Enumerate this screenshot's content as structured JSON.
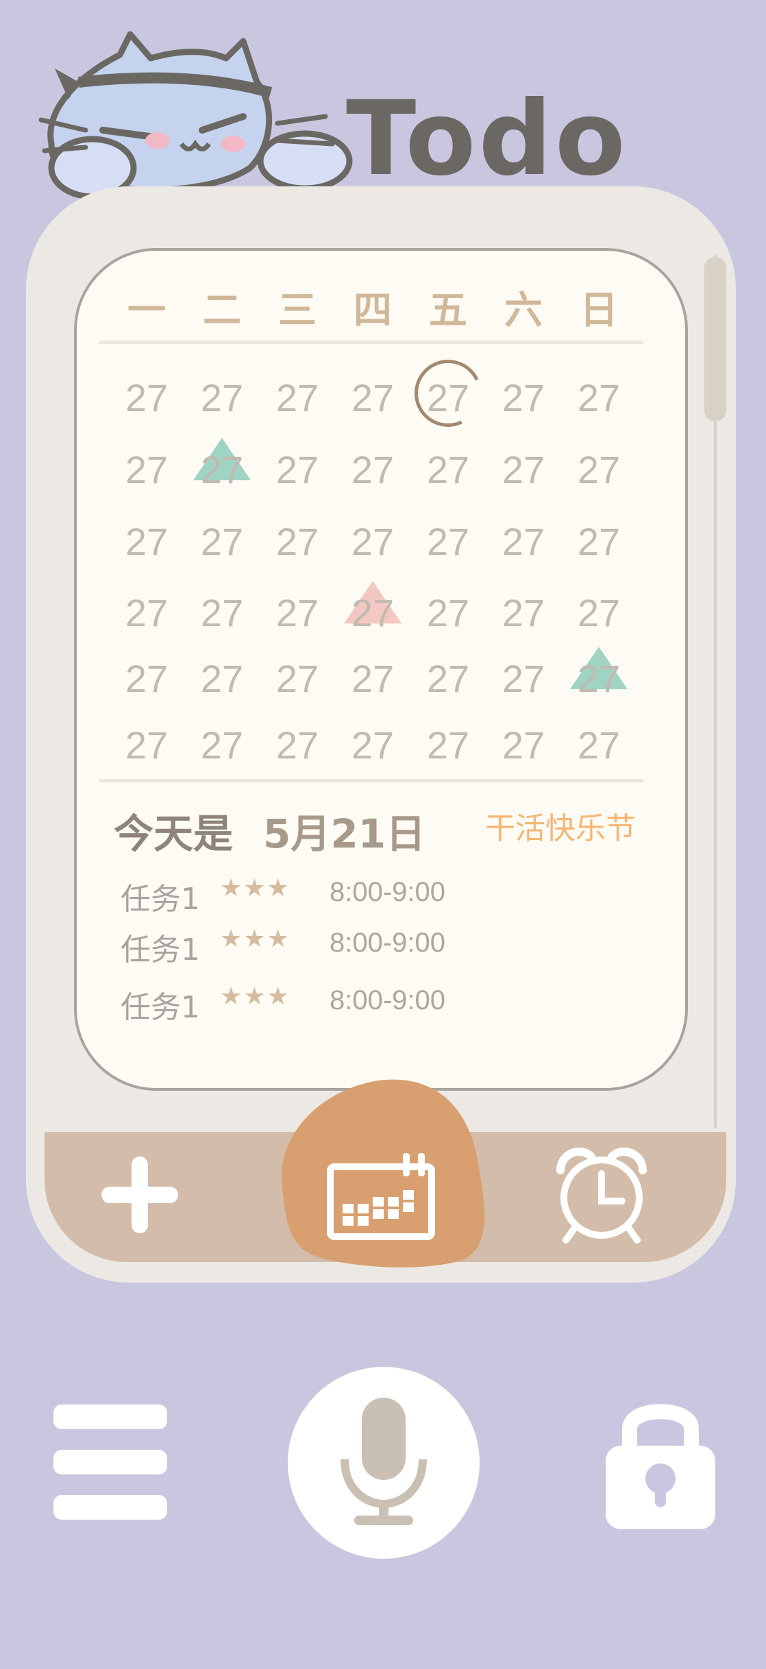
{
  "app": {
    "title": "Todo"
  },
  "calendar": {
    "weekdays": [
      "一",
      "二",
      "三",
      "四",
      "五",
      "六",
      "日"
    ],
    "weeks": [
      [
        "27",
        "27",
        "27",
        "27",
        "27",
        "27",
        "27"
      ],
      [
        "27",
        "27",
        "27",
        "27",
        "27",
        "27",
        "27"
      ],
      [
        "27",
        "27",
        "27",
        "27",
        "27",
        "27",
        "27"
      ],
      [
        "27",
        "27",
        "27",
        "27",
        "27",
        "27",
        "27"
      ],
      [
        "27",
        "27",
        "27",
        "27",
        "27",
        "27",
        "27"
      ],
      [
        "27",
        "27",
        "27",
        "27",
        "27",
        "27",
        "27"
      ]
    ],
    "selected": {
      "week": 0,
      "day": 4
    },
    "markers": [
      {
        "week": 1,
        "day": 1,
        "color": "#9fd3c4"
      },
      {
        "week": 3,
        "day": 3,
        "color": "#f3c7c2"
      },
      {
        "week": 4,
        "day": 6,
        "color": "#9fd3c4"
      }
    ]
  },
  "today": {
    "label": "今天是",
    "date": "5月21日",
    "holiday": "干活快乐节"
  },
  "tasks": [
    {
      "name": "任务1",
      "stars": "★★★",
      "time": "8:00-9:00"
    },
    {
      "name": "任务1",
      "stars": "★★★",
      "time": "8:00-9:00"
    },
    {
      "name": "任务1",
      "stars": "★★★",
      "time": "8:00-9:00"
    }
  ],
  "toolbar": {
    "add_icon": "plus-icon",
    "calendar_icon": "calendar-icon",
    "alarm_icon": "alarm-clock-icon"
  },
  "bottom_nav": {
    "menu_icon": "hamburger-menu-icon",
    "mic_icon": "microphone-icon",
    "lock_icon": "lock-icon"
  },
  "colors": {
    "background": "#c9c7e0",
    "accent": "#d8a070",
    "holiday": "#f6b673",
    "tabbar": "#d3bdaa"
  }
}
